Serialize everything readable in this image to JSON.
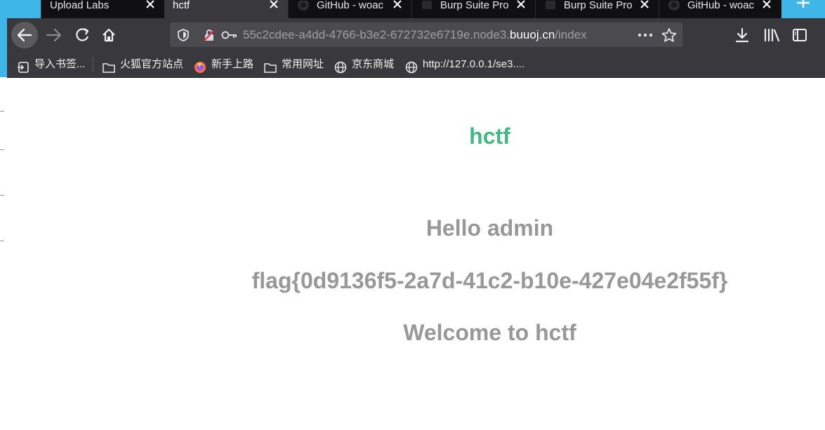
{
  "tabs": [
    {
      "label": "Upload Labs",
      "active": false,
      "icon": ""
    },
    {
      "label": "hctf",
      "active": true,
      "icon": ""
    },
    {
      "label": "GitHub - woac",
      "active": false,
      "icon": "github-icon"
    },
    {
      "label": "Burp Suite Pro",
      "active": false,
      "icon": "burp-icon"
    },
    {
      "label": "Burp Suite Pro",
      "active": false,
      "icon": "burp-icon"
    },
    {
      "label": "GitHub - woac",
      "active": false,
      "icon": "github-icon"
    }
  ],
  "url": {
    "prefix": "55c2cdee-a4dd-4766-b3e2-672732e6719e.node3.",
    "host": "buuoj.cn",
    "path": "/index"
  },
  "bookmarks": [
    {
      "label": "导入书签...",
      "icon": "import-icon"
    },
    {
      "label": "火狐官方站点",
      "icon": "folder-icon"
    },
    {
      "label": "新手上路",
      "icon": "firefox-icon"
    },
    {
      "label": "常用网址",
      "icon": "folder-icon"
    },
    {
      "label": "京东商城",
      "icon": "globe-icon"
    },
    {
      "label": "http://127.0.0.1/se3....",
      "icon": "globe-icon"
    }
  ],
  "page": {
    "title": "hctf",
    "greeting": "Hello admin",
    "flag": "flag{0d9136f5-2a7d-41c2-b10e-427e04e2f55f}",
    "welcome": "Welcome to hctf"
  },
  "colors": {
    "title_green": "#42b983",
    "text_gray": "#989898",
    "chrome_dark": "#38383d",
    "desktop_blue": "#3fb6e8"
  }
}
